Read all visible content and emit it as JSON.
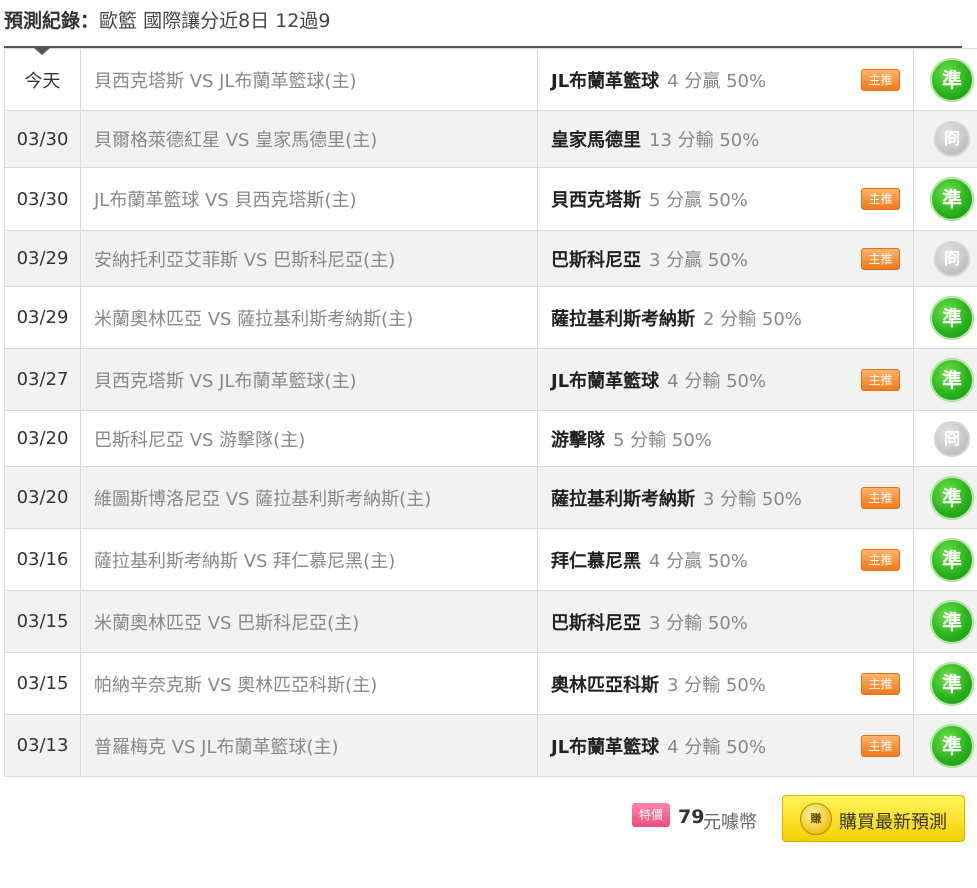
{
  "header": {
    "label": "預測紀錄",
    "separator": "：",
    "category": "歐籃 國際讓分近8日 12過9"
  },
  "rows": [
    {
      "date": "今天",
      "match": "貝西克塔斯 VS JL布蘭革籃球(主)",
      "team": "JL布蘭革籃球",
      "odds": "4 分贏 50%",
      "tag": "主推",
      "result": "準",
      "result_type": "win"
    },
    {
      "date": "03/30",
      "match": "貝爾格萊德紅星 VS 皇家馬德里(主)",
      "team": "皇家馬德里",
      "odds": "13 分輸 50%",
      "tag": "",
      "result": "冏",
      "result_type": "miss"
    },
    {
      "date": "03/30",
      "match": "JL布蘭革籃球 VS 貝西克塔斯(主)",
      "team": "貝西克塔斯",
      "odds": "5 分贏 50%",
      "tag": "主推",
      "result": "準",
      "result_type": "win"
    },
    {
      "date": "03/29",
      "match": "安納托利亞艾菲斯 VS 巴斯科尼亞(主)",
      "team": "巴斯科尼亞",
      "odds": "3 分贏 50%",
      "tag": "主推",
      "result": "冏",
      "result_type": "miss"
    },
    {
      "date": "03/29",
      "match": "米蘭奧林匹亞 VS 薩拉基利斯考納斯(主)",
      "team": "薩拉基利斯考納斯",
      "odds": "2 分輸 50%",
      "tag": "",
      "result": "準",
      "result_type": "win"
    },
    {
      "date": "03/27",
      "match": "貝西克塔斯 VS JL布蘭革籃球(主)",
      "team": "JL布蘭革籃球",
      "odds": "4 分輸 50%",
      "tag": "主推",
      "result": "準",
      "result_type": "win"
    },
    {
      "date": "03/20",
      "match": "巴斯科尼亞 VS 游擊隊(主)",
      "team": "游擊隊",
      "odds": "5 分輸 50%",
      "tag": "",
      "result": "冏",
      "result_type": "miss"
    },
    {
      "date": "03/20",
      "match": "維圖斯博洛尼亞 VS 薩拉基利斯考納斯(主)",
      "team": "薩拉基利斯考納斯",
      "odds": "3 分輸 50%",
      "tag": "主推",
      "result": "準",
      "result_type": "win"
    },
    {
      "date": "03/16",
      "match": "薩拉基利斯考納斯 VS 拜仁慕尼黑(主)",
      "team": "拜仁慕尼黑",
      "odds": "4 分贏 50%",
      "tag": "主推",
      "result": "準",
      "result_type": "win"
    },
    {
      "date": "03/15",
      "match": "米蘭奧林匹亞 VS 巴斯科尼亞(主)",
      "team": "巴斯科尼亞",
      "odds": "3 分輸 50%",
      "tag": "",
      "result": "準",
      "result_type": "win"
    },
    {
      "date": "03/15",
      "match": "帕納辛奈克斯 VS 奧林匹亞科斯(主)",
      "team": "奧林匹亞科斯",
      "odds": "3 分輸 50%",
      "tag": "主推",
      "result": "準",
      "result_type": "win"
    },
    {
      "date": "03/13",
      "match": "普羅梅克 VS JL布蘭革籃球(主)",
      "team": "JL布蘭革籃球",
      "odds": "4 分輸 50%",
      "tag": "主推",
      "result": "準",
      "result_type": "win"
    }
  ],
  "footer": {
    "sale_tag": "特價",
    "price": "79",
    "unit": "元噱幣",
    "coin_text": "賺",
    "buy_label": "購買最新預測"
  },
  "colors": {
    "win": "#27b01c",
    "miss": "#bdbdbd",
    "tag": "#f07a1a",
    "sale": "#ee4d7c",
    "button": "#f5d000"
  }
}
